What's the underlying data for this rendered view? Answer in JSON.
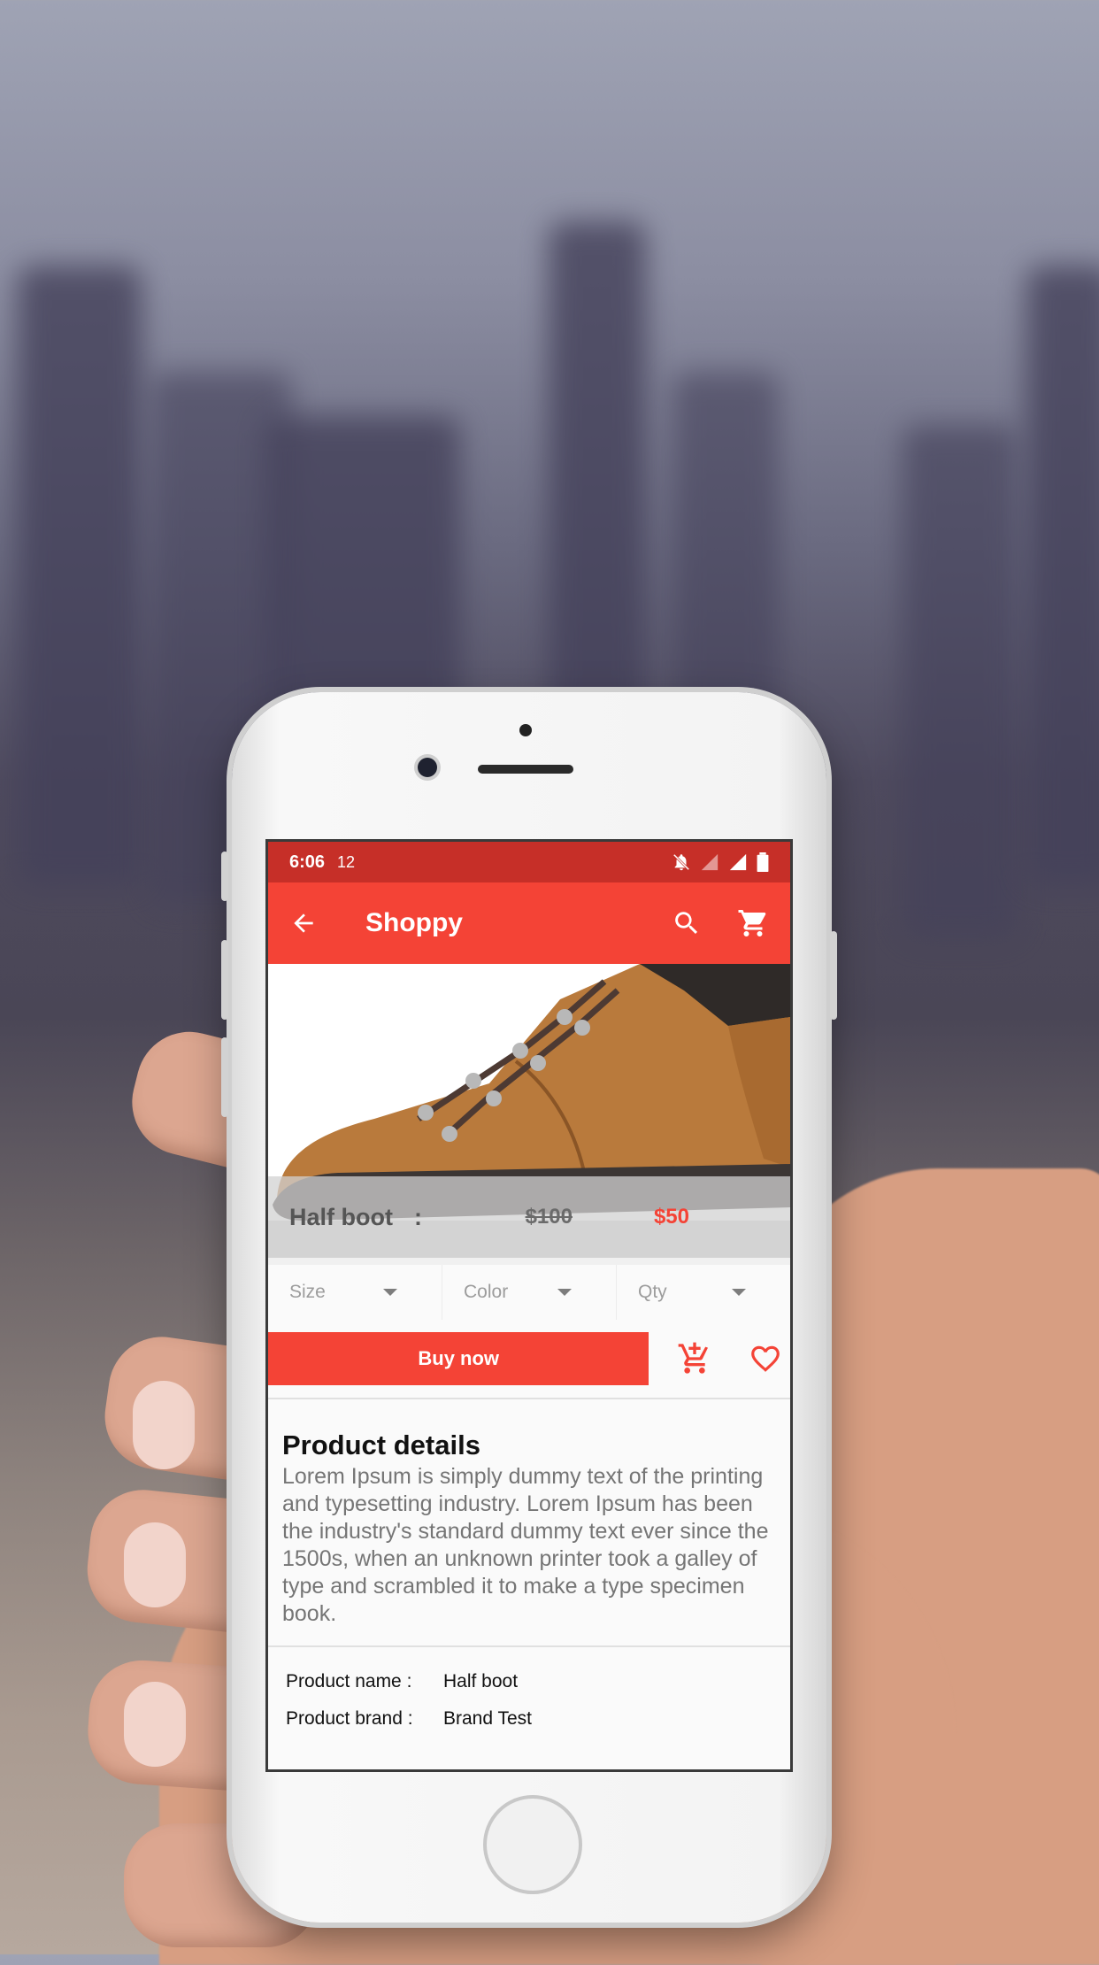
{
  "statusbar": {
    "time": "6:06",
    "notification": "12"
  },
  "appbar": {
    "title": "Shoppy"
  },
  "product": {
    "name": "Half boot",
    "separator": ":",
    "old_price": "$100",
    "new_price": "$50"
  },
  "selectors": {
    "size": "Size",
    "color": "Color",
    "qty": "Qty"
  },
  "actions": {
    "buy_label": "Buy now"
  },
  "details": {
    "heading": "Product details",
    "text": "Lorem Ipsum is simply dummy text of the printing and typesetting industry. Lorem Ipsum has been the industry's standard dummy text ever since the 1500s, when an unknown printer took a galley of type and scrambled it to make a type specimen book."
  },
  "specs": [
    {
      "key": "Product name :",
      "value": "Half boot"
    },
    {
      "key": "Product brand :",
      "value": "Brand Test"
    }
  ],
  "colors": {
    "primary": "#f44336",
    "status": "#c62f28"
  },
  "icons": [
    "back-arrow-icon",
    "search-icon",
    "cart-icon",
    "add-to-cart-icon",
    "heart-icon",
    "bell-off-icon",
    "signal-icon",
    "battery-icon"
  ]
}
